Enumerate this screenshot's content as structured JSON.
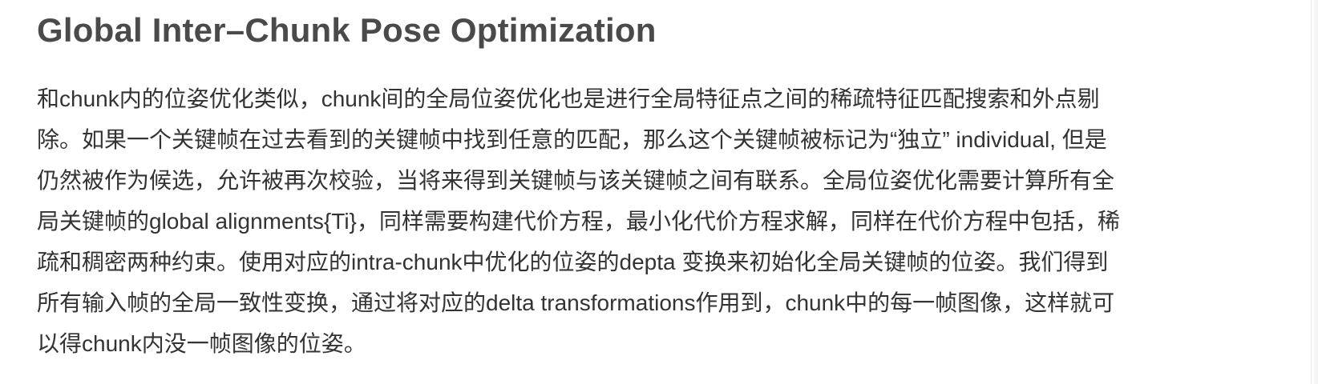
{
  "section": {
    "title": "Global Inter–Chunk Pose Optimization",
    "paragraph_lines": [
      "和chunk内的位姿优化类似，chunk间的全局位姿优化也是进行全局特征点之间的稀疏特征匹配搜索和外点剔",
      "除。如果一个关键帧在过去看到的关键帧中找到任意的匹配，那么这个关键帧被标记为“独立” individual, 但是",
      "仍然被作为候选，允许被再次校验，当将来得到关键帧与该关键帧之间有联系。全局位姿优化需要计算所有全",
      "局关键帧的global alignments{Ti}，同样需要构建代价方程，最小化代价方程求解，同样在代价方程中包括，稀",
      "疏和稠密两种约束。使用对应的intra-chunk中优化的位姿的depta 变换来初始化全局关键帧的位姿。我们得到",
      "所有输入帧的全局一致性变换，通过将对应的delta transformations作用到，chunk中的每一帧图像，这样就可",
      "以得chunk内没一帧图像的位姿。"
    ]
  }
}
